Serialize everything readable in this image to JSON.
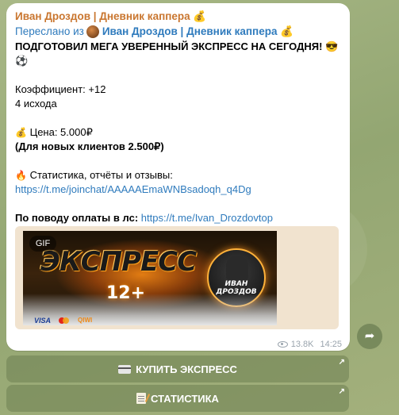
{
  "message": {
    "channel_name": "Иван Дроздов | Дневник каппера 💰",
    "forwarded_prefix": "Переслано из",
    "forwarded_from": "Иван Дроздов | Дневник каппера 💰",
    "headline": "ПОДГОТОВИЛ МЕГА УВЕРЕННЫЙ ЭКСПРЕСС НА СЕГОДНЯ! 😎",
    "headline_emoji": "⚽",
    "coefficient": "Коэффициент: +12",
    "outcomes": "4 исхода",
    "price_emoji": "💰",
    "price": "Цена: 5.000₽",
    "new_clients_price": "(Для новых клиентов 2.500₽)",
    "stats_emoji": "🔥",
    "stats_text": "Статистика, отчёты и отзывы:",
    "stats_link": "https://t.me/joinchat/AAAAAEmaWNBsadoqh_q4Dg",
    "payment_text": "По поводу оплаты в лс:",
    "payment_link": "https://t.me/Ivan_Drozdovtop",
    "views": "13.8K",
    "time": "14:25"
  },
  "media": {
    "badge": "GIF",
    "banner_title": "ЭКСПРЕСС",
    "banner_sub": "12+",
    "logo_text": "ИВАН ДРОЗДОВ",
    "payments": [
      "VISA",
      "MasterCard",
      "QIWI"
    ]
  },
  "keyboard": {
    "buttons": [
      {
        "label": "КУПИТЬ ЭКСПРЕСС",
        "icon": "credit-card-icon"
      },
      {
        "label": "СТАТИСТИКА",
        "icon": "memo-icon"
      }
    ]
  },
  "colors": {
    "channel_name": "#c9762f",
    "link": "#2f7bbd",
    "keyboard_bg": "#6e8052"
  }
}
